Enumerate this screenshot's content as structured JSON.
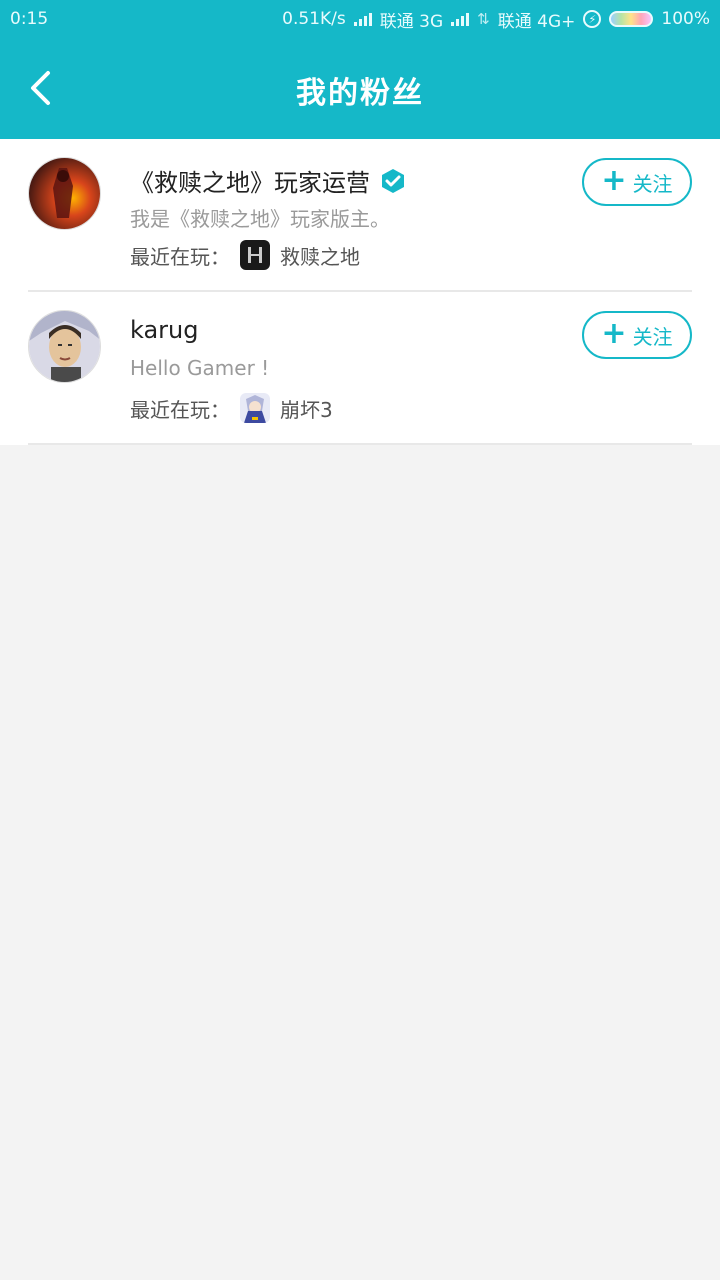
{
  "status_bar": {
    "time": "0:15",
    "speed": "0.51K/s",
    "carrier1": "联通 3G",
    "carrier2": "联通 4G+",
    "battery": "100%"
  },
  "header": {
    "title": "我的粉丝"
  },
  "colors": {
    "accent": "#15b8c8"
  },
  "fans": [
    {
      "name": "《救赎之地》玩家运营",
      "verified": true,
      "signature": "我是《救赎之地》玩家版主。",
      "recent_label": "最近在玩：",
      "game": "救赎之地",
      "follow_label": "关注"
    },
    {
      "name": "karug",
      "verified": false,
      "signature": "Hello Gamer !",
      "recent_label": "最近在玩：",
      "game": "崩坏3",
      "follow_label": "关注"
    }
  ]
}
